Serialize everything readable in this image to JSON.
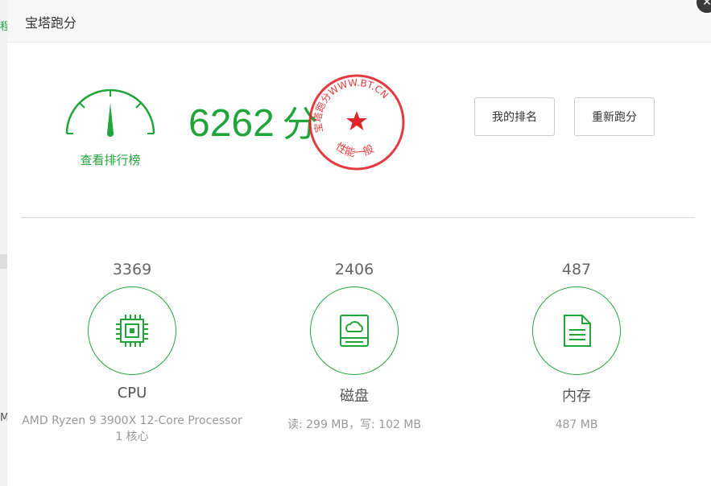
{
  "dialog": {
    "title": "宝塔跑分",
    "close_symbol": "✕"
  },
  "background": {
    "fragment_top": "程",
    "fragment_mid": "My"
  },
  "summary": {
    "score": "6262",
    "score_unit": "分",
    "ranking_link": "查看排行榜",
    "my_rank_label": "我的排名",
    "rerun_label": "重新跑分",
    "seal_top_text": "宝塔跑分WWW.BT.CN",
    "seal_bottom_text": "性能一般"
  },
  "metrics": [
    {
      "value": "3369",
      "name": "CPU",
      "detail_line1": "AMD Ryzen 9 3900X 12-Core Processor",
      "detail_line2": "1 核心",
      "icon": "cpu-chip-icon"
    },
    {
      "value": "2406",
      "name": "磁盘",
      "detail_line1": "读: 299 MB，写: 102 MB",
      "icon": "disk-cloud-icon"
    },
    {
      "value": "487",
      "name": "内存",
      "detail_line1": "487 MB",
      "icon": "memory-doc-icon"
    }
  ],
  "colors": {
    "accent": "#20a53a",
    "seal": "#e0262b"
  }
}
